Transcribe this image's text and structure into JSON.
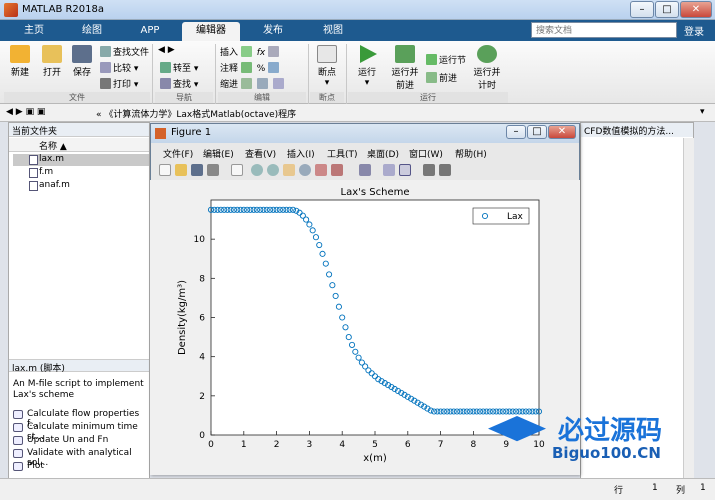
{
  "app": {
    "title": "MATLAB R2018a"
  },
  "tabs": [
    "主页",
    "绘图",
    "APP",
    "编辑器",
    "发布",
    "视图"
  ],
  "active_tab": "编辑器",
  "search": {
    "placeholder": "搜索文档"
  },
  "header": {
    "login": "登录"
  },
  "ribbon": {
    "file_group": {
      "label": "文件",
      "new": "新建",
      "open": "打开",
      "save": "保存",
      "find_files": "查找文件",
      "compare": "比较",
      "print": "打印"
    },
    "nav_group": {
      "label": "导航",
      "goto": "转至",
      "find": "查找"
    },
    "edit_group": {
      "label": "编辑",
      "insert": "插入",
      "comment": "注释",
      "indent": "缩进"
    },
    "bp_group": {
      "label": "断点",
      "breakpoints": "断点"
    },
    "run_group": {
      "label": "运行",
      "run": "运行",
      "run_advance": "运行并前进",
      "run_section": "运行节",
      "advance": "前进",
      "run_time": "运行并计时"
    }
  },
  "address": {
    "path": "« 《计算流体力学》Lax格式Matlab(octave)程序"
  },
  "current_folder": {
    "title": "当前文件夹",
    "column": "名称 ▲",
    "files": [
      "lax.m",
      "f.m",
      "anaf.m"
    ],
    "selected": "lax.m"
  },
  "details": {
    "title": "lax.m (脚本)",
    "description": "An M-file script to implement Lax's scheme",
    "items": [
      "Calculate flow properties f...",
      "Calculate minimum time st...",
      "Update Un and Fn",
      "Validate with analytical sol...",
      "Plot"
    ]
  },
  "editor_tab": "CFD数值模拟的方法...",
  "figure": {
    "title": "Figure 1",
    "menu": [
      "文件(F)",
      "编辑(E)",
      "查看(V)",
      "插入(I)",
      "工具(T)",
      "桌面(D)",
      "窗口(W)",
      "帮助(H)"
    ]
  },
  "status": {
    "row_label": "行",
    "row": "1",
    "col_label": "列",
    "col": "1"
  },
  "watermark": {
    "text1": "必过源码",
    "text2": "Biguo100.CN"
  },
  "colors": {
    "accent": "#1e5a8f",
    "marker": "#0072bd"
  },
  "chart_data": {
    "type": "scatter",
    "title": "Lax's Scheme",
    "xlabel": "x(m)",
    "ylabel": "Density(kg/m³)",
    "xlim": [
      0,
      10
    ],
    "ylim": [
      0,
      12
    ],
    "xticks": [
      0,
      1,
      2,
      3,
      4,
      5,
      6,
      7,
      8,
      9,
      10
    ],
    "yticks": [
      0,
      2,
      4,
      6,
      8,
      10
    ],
    "legend": "top-right",
    "series": [
      {
        "name": "Lax",
        "marker": "circle",
        "x": [
          0,
          0.1,
          0.2,
          0.3,
          0.4,
          0.5,
          0.6,
          0.7,
          0.8,
          0.9,
          1.0,
          1.1,
          1.2,
          1.3,
          1.4,
          1.5,
          1.6,
          1.7,
          1.8,
          1.9,
          2.0,
          2.1,
          2.2,
          2.3,
          2.4,
          2.5,
          2.6,
          2.7,
          2.8,
          2.9,
          3.0,
          3.1,
          3.2,
          3.3,
          3.4,
          3.5,
          3.6,
          3.7,
          3.8,
          3.9,
          4.0,
          4.1,
          4.2,
          4.3,
          4.4,
          4.5,
          4.6,
          4.7,
          4.8,
          4.9,
          5.0,
          5.1,
          5.2,
          5.3,
          5.4,
          5.5,
          5.6,
          5.7,
          5.8,
          5.9,
          6.0,
          6.1,
          6.2,
          6.3,
          6.4,
          6.5,
          6.6,
          6.7,
          6.8,
          6.9,
          7.0,
          7.1,
          7.2,
          7.3,
          7.4,
          7.5,
          7.6,
          7.7,
          7.8,
          7.9,
          8.0,
          8.1,
          8.2,
          8.3,
          8.4,
          8.5,
          8.6,
          8.7,
          8.8,
          8.9,
          9.0,
          9.1,
          9.2,
          9.3,
          9.4,
          9.5,
          9.6,
          9.7,
          9.8,
          9.9,
          10.0
        ],
        "y": [
          11.5,
          11.5,
          11.5,
          11.5,
          11.5,
          11.5,
          11.5,
          11.5,
          11.5,
          11.5,
          11.5,
          11.5,
          11.5,
          11.5,
          11.5,
          11.5,
          11.5,
          11.5,
          11.5,
          11.5,
          11.5,
          11.5,
          11.5,
          11.5,
          11.5,
          11.5,
          11.45,
          11.35,
          11.2,
          11.0,
          10.75,
          10.45,
          10.1,
          9.7,
          9.25,
          8.75,
          8.2,
          7.65,
          7.1,
          6.55,
          6.0,
          5.5,
          5.0,
          4.6,
          4.25,
          3.95,
          3.7,
          3.5,
          3.3,
          3.15,
          3.0,
          2.85,
          2.75,
          2.65,
          2.55,
          2.45,
          2.35,
          2.25,
          2.15,
          2.05,
          1.95,
          1.85,
          1.75,
          1.65,
          1.55,
          1.45,
          1.35,
          1.25,
          1.2,
          1.2,
          1.2,
          1.2,
          1.2,
          1.2,
          1.2,
          1.2,
          1.2,
          1.2,
          1.2,
          1.2,
          1.2,
          1.2,
          1.2,
          1.2,
          1.2,
          1.2,
          1.2,
          1.2,
          1.2,
          1.2,
          1.2,
          1.2,
          1.2,
          1.2,
          1.2,
          1.2,
          1.2,
          1.2,
          1.2,
          1.2,
          1.2
        ]
      }
    ]
  }
}
